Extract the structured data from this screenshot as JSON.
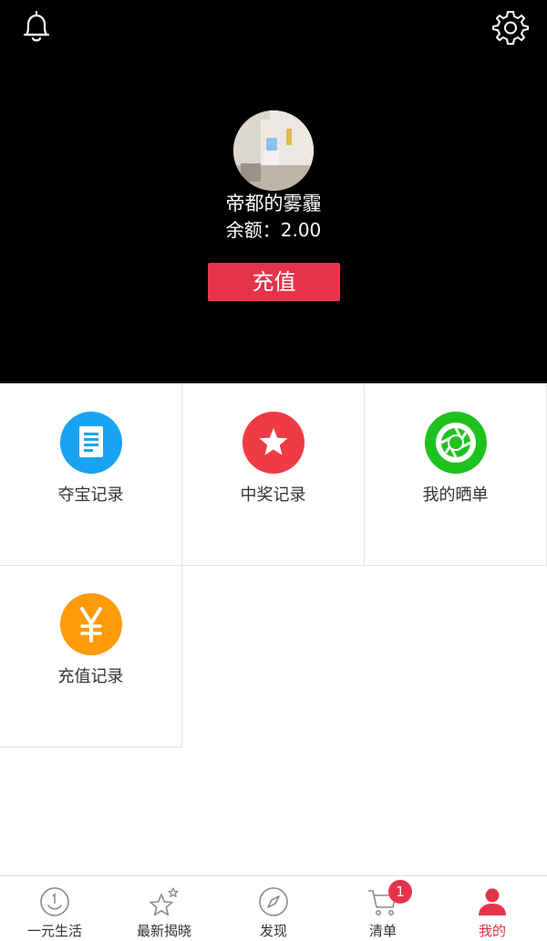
{
  "header": {
    "username": "帝都的雾霾",
    "balance": "余额：2.00",
    "recharge_label": "充值",
    "bell_icon": "bell-icon",
    "settings_icon": "gear-icon"
  },
  "menu": [
    {
      "label": "夺宝记录",
      "icon": "document-icon",
      "color": "#1aa3f0"
    },
    {
      "label": "中奖记录",
      "icon": "star-icon",
      "color": "#ef3b45"
    },
    {
      "label": "我的晒单",
      "icon": "aperture-icon",
      "color": "#1ec21e"
    },
    {
      "label": "充值记录",
      "icon": "yen-icon",
      "color": "#ff9a08"
    }
  ],
  "tabbar": {
    "tabs": [
      {
        "label": "一元生活",
        "icon": "smiley-coin-icon"
      },
      {
        "label": "最新揭晓",
        "icon": "stars-icon"
      },
      {
        "label": "发现",
        "icon": "compass-icon"
      },
      {
        "label": "清单",
        "icon": "cart-icon",
        "badge": "1"
      },
      {
        "label": "我的",
        "icon": "user-icon",
        "active": true
      }
    ]
  },
  "colors": {
    "accent": "#e5344a",
    "header_bg": "#000000"
  }
}
